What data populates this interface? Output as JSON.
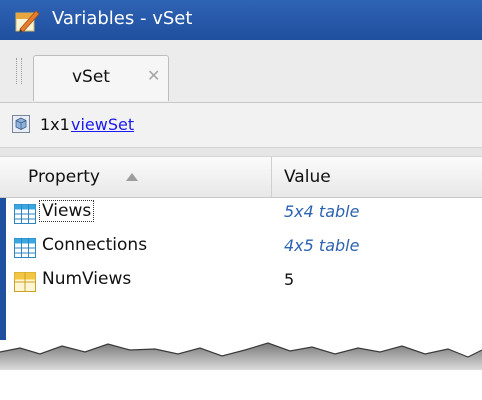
{
  "window": {
    "title": "Variables - vSet"
  },
  "tabs": [
    {
      "label": "vSet",
      "close_icon": "close-icon"
    }
  ],
  "info": {
    "dimensions": "1x1",
    "class_link": "viewSet"
  },
  "table": {
    "columns": [
      "Property",
      "Value"
    ],
    "sort_column": "Property",
    "rows": [
      {
        "name": "Views",
        "value": "5x4 table",
        "icon": "table-icon",
        "value_style": "link-italic"
      },
      {
        "name": "Connections",
        "value": "4x5 table",
        "icon": "table-icon",
        "value_style": "link-italic"
      },
      {
        "name": "NumViews",
        "value": "5",
        "icon": "numeric-icon",
        "value_style": "plain"
      }
    ]
  },
  "colors": {
    "titlebar": "#1f4f9f",
    "link": "#1a1aee",
    "table_value": "#2d63b0",
    "grid_icon": "#3aa7e0",
    "numeric_icon": "#f4c542"
  }
}
